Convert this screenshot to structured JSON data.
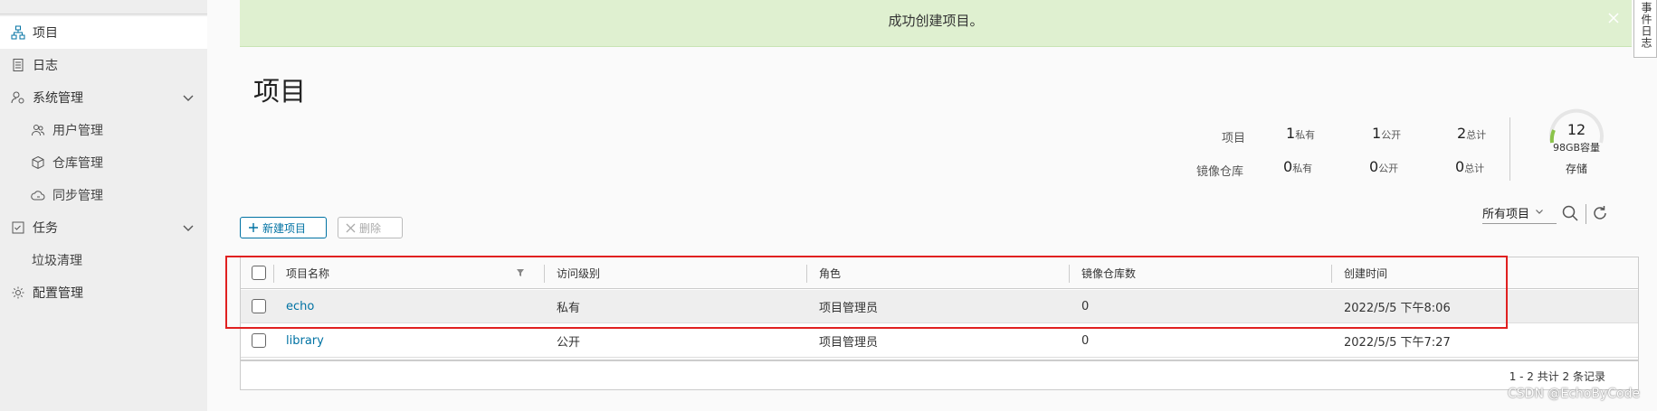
{
  "sidebar": {
    "items": [
      {
        "label": "项目",
        "icon": "project-tree-icon"
      },
      {
        "label": "日志",
        "icon": "log-document-icon"
      },
      {
        "label": "系统管理",
        "icon": "admin-gear-user-icon"
      },
      {
        "label": "用户管理",
        "icon": "users-icon"
      },
      {
        "label": "仓库管理",
        "icon": "box-icon"
      },
      {
        "label": "同步管理",
        "icon": "cloud-sync-icon"
      },
      {
        "label": "任务",
        "icon": "task-checklist-icon"
      },
      {
        "label": "垃圾清理",
        "icon": ""
      },
      {
        "label": "配置管理",
        "icon": "settings-gear-icon"
      }
    ]
  },
  "banner": {
    "message": "成功创建项目。",
    "color": "#dff0d0"
  },
  "side_tab": {
    "label": "事件日志"
  },
  "page": {
    "title": "项目"
  },
  "stats": {
    "projects_label": "项目",
    "repos_label": "镜像仓库",
    "projects": {
      "private": "1",
      "public": "1",
      "total": "2"
    },
    "repos": {
      "private": "0",
      "public": "0",
      "total": "0"
    },
    "private_unit": "私有",
    "public_unit": "公开",
    "total_unit": "总计",
    "quota": {
      "value": "12",
      "capacity": "98GB容量",
      "label": "存储"
    }
  },
  "toolbar": {
    "new_project": "新建项目",
    "delete": "删除",
    "filter_selected": "所有项目"
  },
  "table": {
    "columns": [
      "项目名称",
      "访问级别",
      "角色",
      "镜像仓库数",
      "创建时间"
    ],
    "rows": [
      {
        "name": "echo",
        "access": "私有",
        "role": "项目管理员",
        "repo_count": "0",
        "created": "2022/5/5 下午8:06"
      },
      {
        "name": "library",
        "access": "公开",
        "role": "项目管理员",
        "repo_count": "0",
        "created": "2022/5/5 下午7:27"
      }
    ],
    "footer": "1 - 2 共计 2 条记录"
  },
  "watermark": "CSDN @EchoByCode",
  "colors": {
    "accent": "#0072a3",
    "highlight_border": "#e02020"
  }
}
